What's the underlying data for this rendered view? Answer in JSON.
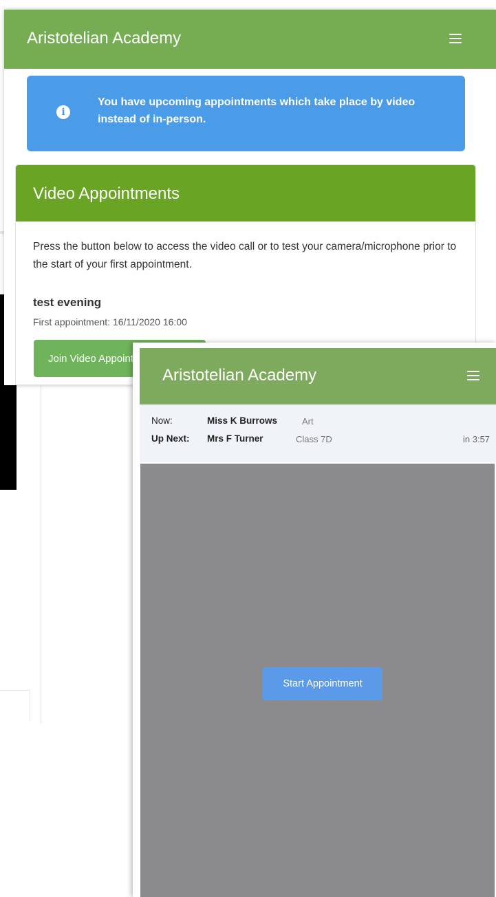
{
  "screenshot1": {
    "header": {
      "title": "Aristotelian Academy",
      "menu_icon": "hamburger-menu-icon"
    },
    "alert": {
      "icon": "info-circle-icon",
      "message": "You have upcoming appointments which take place by video instead of in-person."
    },
    "card": {
      "title": "Video Appointments",
      "description": "Press the button below to access the video call or to test your camera/microphone prior to the start of your first appointment.",
      "event_name": "test evening",
      "first_appointment": "First appointment: 16/11/2020 16:00",
      "join_button": "Join Video Appointments"
    }
  },
  "screenshot2": {
    "header": {
      "title": "Aristotelian Academy",
      "menu_icon": "hamburger-menu-icon"
    },
    "now": {
      "label": "Now:",
      "name": "Miss K Burrows",
      "subject": "Art"
    },
    "up_next": {
      "label": "Up Next:",
      "name": "Mrs F Turner",
      "subject": "Class 7D",
      "time": "in 3:57"
    },
    "start_button": "Start Appointment"
  },
  "colors": {
    "header_green": "#76ad52",
    "card_header_green": "#6aa424",
    "alert_blue": "#4a9ce8",
    "join_button_green": "#6fb35a",
    "start_button_blue": "#5b9ae8",
    "video_grey": "#8b8b8d"
  }
}
